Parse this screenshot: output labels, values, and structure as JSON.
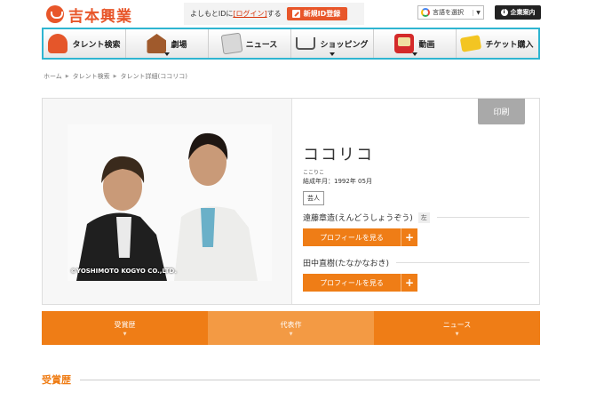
{
  "header": {
    "logo_text": "吉本興業",
    "login_prefix": "よしもとIDに",
    "login_link": "[ログイン]",
    "login_suffix": "する",
    "register_label": "新規ID登録",
    "language_label": "言語を選択",
    "language_caret": "▼",
    "corporate_label": "企業案内",
    "corporate_icon": "i"
  },
  "nav": {
    "items": [
      {
        "label": "タレント検索",
        "icon": "talent-icon",
        "dropdown": false
      },
      {
        "label": "劇場",
        "icon": "theater-icon",
        "dropdown": true
      },
      {
        "label": "ニュース",
        "icon": "news-icon",
        "dropdown": false
      },
      {
        "label": "ショッピング",
        "icon": "shopping-icon",
        "dropdown": true
      },
      {
        "label": "動画",
        "icon": "video-icon",
        "dropdown": true
      },
      {
        "label": "チケット購入",
        "icon": "ticket-icon",
        "dropdown": false
      }
    ]
  },
  "breadcrumb": [
    "ホーム",
    "タレント検索",
    "タレント詳細(ココリコ)"
  ],
  "breadcrumb_sep": "▶",
  "profile": {
    "print_label": "印刷",
    "photo_credit": "©YOSHIMOTO KOGYO CO.,LTD.",
    "name": "ココリコ",
    "kana": "ここりこ",
    "formed": "結成年月：1992年 05月",
    "category": "芸人",
    "members": [
      {
        "name": "遠藤章造(えんどうしょうぞう)",
        "position": "左",
        "button": "プロフィールを見る",
        "plus": "+"
      },
      {
        "name": "田中直樹(たなかなおき)",
        "position": "",
        "button": "プロフィールを見る",
        "plus": "+"
      }
    ]
  },
  "tabs": [
    {
      "label": "受賞歴",
      "arrow": "▼"
    },
    {
      "label": "代表作",
      "arrow": "▼"
    },
    {
      "label": "ニュース",
      "arrow": "▼"
    }
  ],
  "section": {
    "title": "受賞歴"
  },
  "colors": {
    "accent": "#ef7d16",
    "brand": "#e8562a",
    "nav_border": "#2fb5d1"
  }
}
